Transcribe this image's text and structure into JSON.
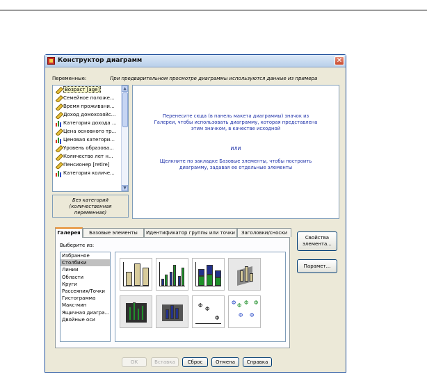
{
  "window": {
    "title": "Конструктор диаграмм"
  },
  "variables": {
    "label": "Переменные:",
    "hint": "При предварительном просмотре диаграммы используются данные из примера",
    "items": [
      {
        "label": "Возраст [age]",
        "icon": "scale-pencil-icon",
        "selected": true
      },
      {
        "label": "Семейное положе...",
        "icon": "scale-pencil-icon"
      },
      {
        "label": "Время проживани...",
        "icon": "scale-pencil-icon"
      },
      {
        "label": "Доход домохозяйс...",
        "icon": "scale-pencil-icon"
      },
      {
        "label": "Категория дохода ...",
        "icon": "ordinal-bars-icon"
      },
      {
        "label": "Цена основного тр...",
        "icon": "scale-pencil-icon"
      },
      {
        "label": "Ценовая категори...",
        "icon": "ordinal-bars-icon"
      },
      {
        "label": "Уровень образова...",
        "icon": "scale-pencil-icon"
      },
      {
        "label": "Количество лет н...",
        "icon": "scale-pencil-icon"
      },
      {
        "label": "Пенсионер [retire]",
        "icon": "scale-pencil-icon"
      },
      {
        "label": "Категория количе...",
        "icon": "ordinal-bars-icon"
      }
    ],
    "no_categories": [
      "Без категорий",
      "(количественная",
      "переменная)"
    ]
  },
  "canvas": {
    "instruction_1": "Перенесите сюда (в панель макета диаграммы) значок из Галереи, чтобы использовать диаграмму, которая представлена этим значком, в качестве исходной",
    "or": "ИЛИ",
    "instruction_2": "Щелкните по закладке Базовые элементы, чтобы построить диаграмму, задавая ее отдельные элементы"
  },
  "tabs": [
    "Галерея",
    "Базовые элементы",
    "Идентификатор группы или точки",
    "Заголовки/сноски"
  ],
  "gallery": {
    "choose_label": "Выберите из:",
    "categories": [
      "Избранное",
      "Столбики",
      "Линии",
      "Области",
      "Круги",
      "Рассеяния/Точки",
      "Гистограмма",
      "Макс-мин",
      "Ящичная диагра...",
      "Двойные оси"
    ],
    "selected_index": 1
  },
  "buttons": {
    "element_properties": "Свойства элемента...",
    "options": "Парамет...",
    "ok": "ОК",
    "paste": "Вставка",
    "reset": "Сброс",
    "cancel": "Отмена",
    "help": "Справка"
  },
  "colors": {
    "tan_bar": "#d8cc9c",
    "green_bar": "#1f8f2a",
    "navy_bar": "#22308a",
    "canvas_text": "#1c2fa8"
  }
}
